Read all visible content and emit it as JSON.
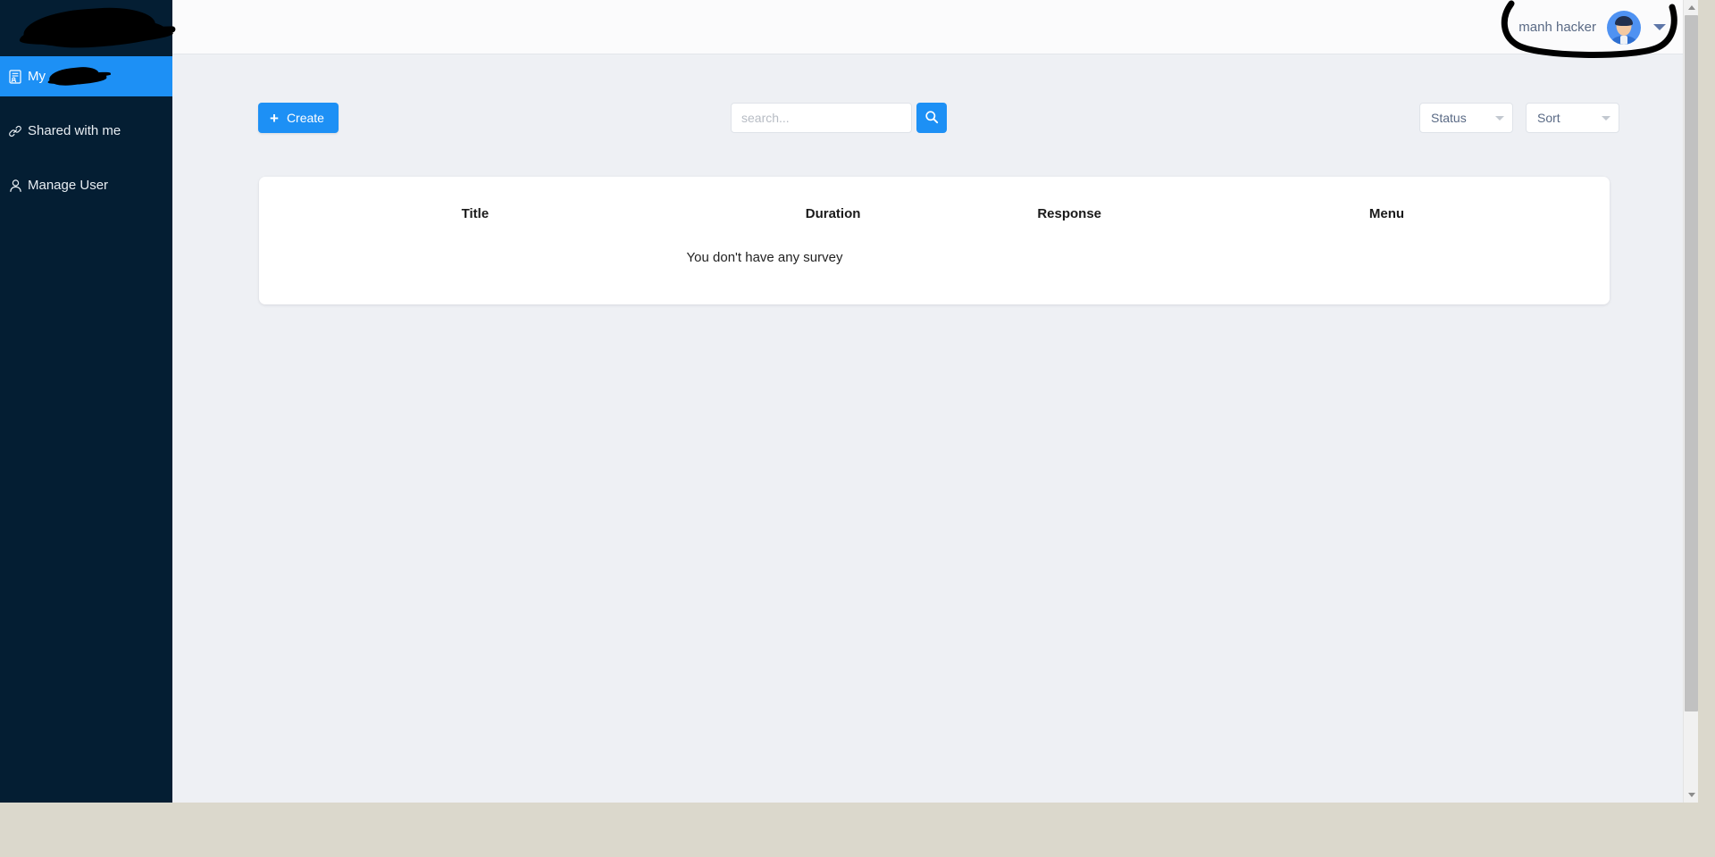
{
  "sidebar": {
    "logo": {
      "name": "app-logo",
      "redacted": true
    },
    "items": [
      {
        "label": "My",
        "redacted_suffix": true,
        "icon": "survey-document-icon",
        "active": true
      },
      {
        "label": "Shared with me",
        "redacted_suffix": false,
        "icon": "link-icon",
        "active": false
      },
      {
        "label": "Manage User",
        "redacted_suffix": false,
        "icon": "user-icon",
        "active": false
      }
    ],
    "background_color": "#041e33",
    "active_color": "#1d90f5"
  },
  "header": {
    "user_name": "manh hacker",
    "avatar_icon": "user-avatar",
    "caret_icon": "chevron-down-icon",
    "annotation": "hand-drawn-highlight-curve"
  },
  "toolbar": {
    "create_label": "Create",
    "create_plus": "+",
    "search_placeholder": "search...",
    "search_value": "",
    "search_button_icon": "search-icon",
    "filters": [
      {
        "label": "Status",
        "name": "status-filter"
      },
      {
        "label": "Sort",
        "name": "sort-filter"
      }
    ]
  },
  "table": {
    "columns": [
      "Title",
      "Duration",
      "Response",
      "Menu"
    ],
    "rows": [],
    "empty_message": "You don't have any survey"
  },
  "colors": {
    "accent": "#1d90f5",
    "sidebar": "#041e33",
    "page_bg": "#eef0f4",
    "card_bg": "#ffffff",
    "desktop": "#dbd8cc"
  }
}
